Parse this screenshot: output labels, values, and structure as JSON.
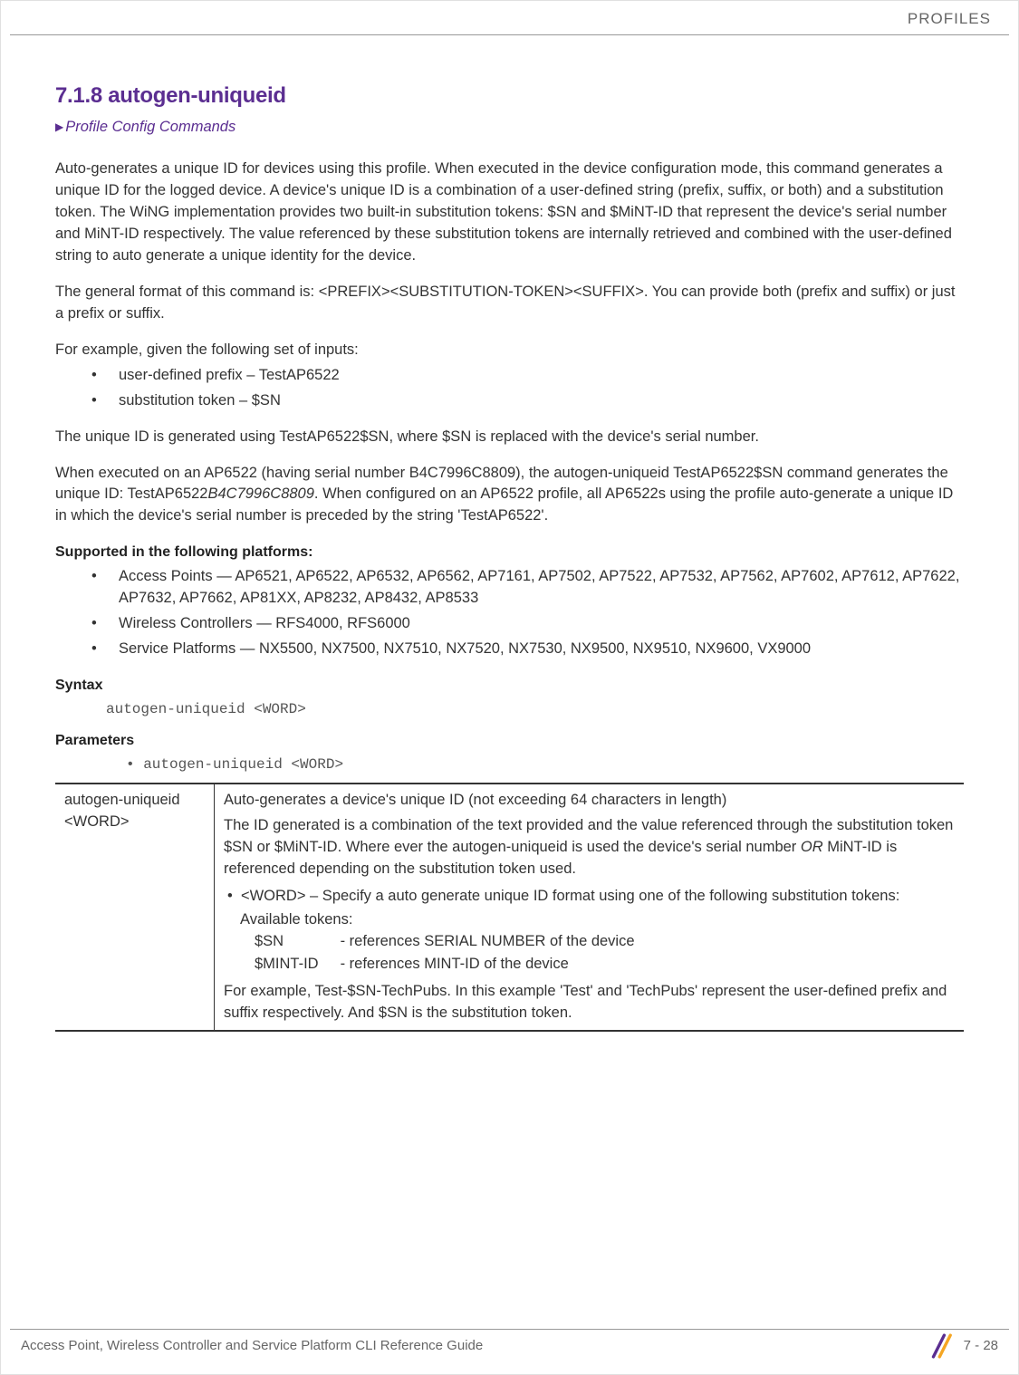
{
  "header": {
    "category": "PROFILES"
  },
  "heading": "7.1.8 autogen-uniqueid",
  "breadcrumb": "Profile Config Commands",
  "paragraphs": {
    "intro": "Auto-generates a unique ID for devices using this profile. When executed in the device configuration mode, this command generates a unique ID for the logged device. A device's unique ID is a combination of a user-defined string (prefix, suffix, or both) and a substitution token. The WiNG implementation provides two built-in substitution tokens: $SN and $MiNT-ID that represent the device's serial number and MiNT-ID respectively. The value referenced by these substitution tokens are internally retrieved and combined with the user-defined string to auto generate a unique identity for the device.",
    "general_format": "The general format of this command is: <PREFIX><SUBSTITUTION-TOKEN><SUFFIX>. You can provide both (prefix and suffix) or just a prefix or suffix.",
    "example_intro": "For example, given the following set of inputs:",
    "example_result": "The unique ID is generated using TestAP6522$SN, where $SN is replaced with the device's serial number.",
    "example_detail_pre": "When executed on an AP6522 (having serial number B4C7996C8809), the autogen-uniqueid TestAP6522$SN command generates the unique ID: TestAP6522",
    "example_detail_serial": "B4C7996C8809",
    "example_detail_post": ". When configured on an AP6522 profile, all AP6522s using the profile auto-generate a unique ID in which the device's serial number is preceded by the string 'TestAP6522'."
  },
  "example_inputs": [
    "user-defined prefix – TestAP6522",
    "substitution token – $SN"
  ],
  "supported": {
    "heading": "Supported in the following platforms:",
    "items": [
      "Access Points — AP6521, AP6522, AP6532, AP6562, AP7161, AP7502, AP7522, AP7532, AP7562, AP7602, AP7612, AP7622, AP7632, AP7662, AP81XX, AP8232, AP8432, AP8533",
      "Wireless Controllers — RFS4000, RFS6000",
      "Service Platforms — NX5500, NX7500, NX7510, NX7520, NX7530, NX9500, NX9510, NX9600, VX9000"
    ]
  },
  "syntax": {
    "heading": "Syntax",
    "code": "autogen-uniqueid <WORD>"
  },
  "parameters": {
    "heading": "Parameters",
    "bullet": "• autogen-uniqueid <WORD>",
    "left_cell_l1": "autogen-uniqueid",
    "left_cell_l2": "<WORD>",
    "right": {
      "line1": "Auto-generates a device's unique ID (not exceeding 64 characters in length)",
      "line2_pre": "The ID generated is a combination of the text provided and the value referenced through the substitution token $SN or $MiNT-ID. Where ever the autogen-uniqueid is used the device's serial number ",
      "line2_or": "OR",
      "line2_post": " MiNT-ID is referenced depending on the substitution token used.",
      "word_line": "<WORD> – Specify a auto generate unique ID format using one of the following substitution tokens:",
      "avail_tokens": "Available tokens:",
      "token1_key": "$SN",
      "token1_desc": "- references SERIAL NUMBER of the device",
      "token2_key": "$MINT-ID",
      "token2_desc": "- references MINT-ID of the device",
      "example_line": "For example, Test-$SN-TechPubs. In this example 'Test' and 'TechPubs' represent the user-defined prefix and suffix respectively. And $SN is the substitution token."
    }
  },
  "footer": {
    "guide": "Access Point, Wireless Controller and Service Platform CLI Reference Guide",
    "page": "7 - 28"
  }
}
